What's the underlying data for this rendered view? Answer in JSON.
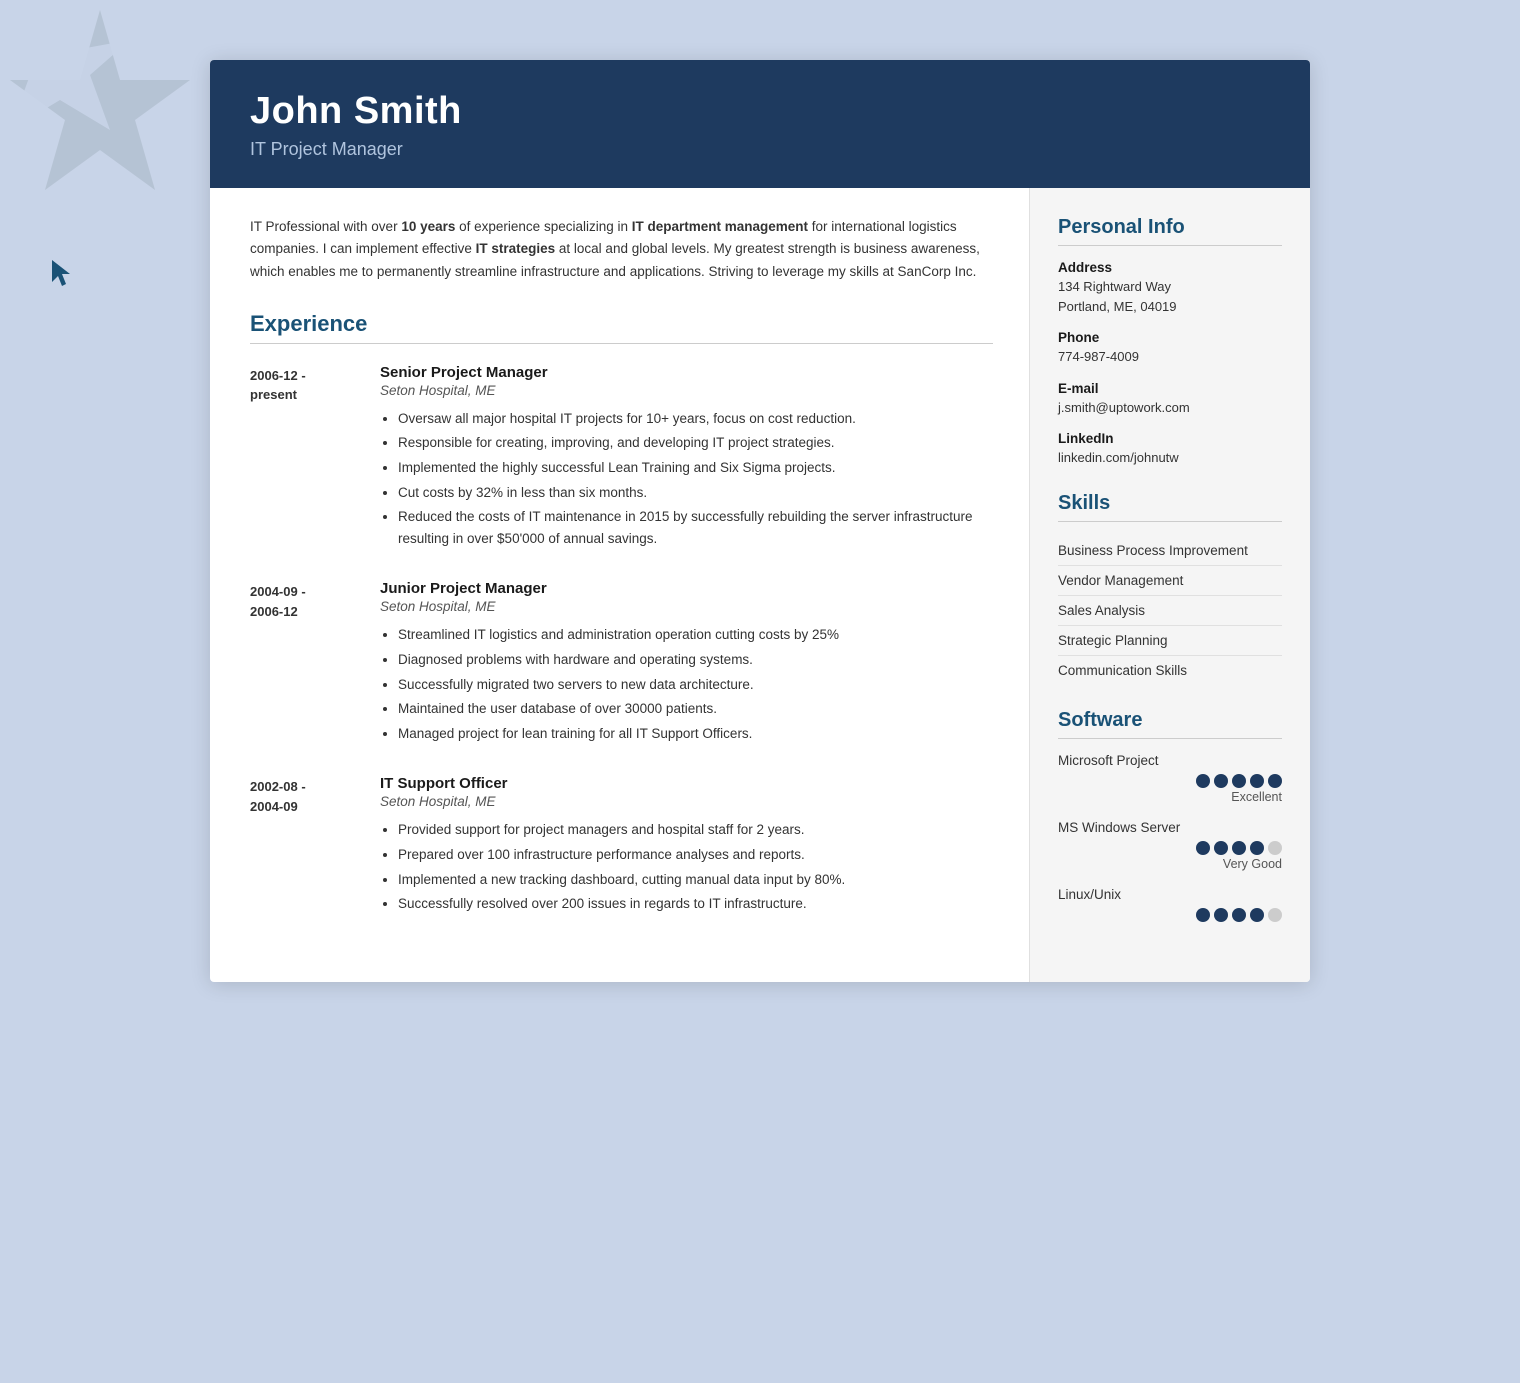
{
  "header": {
    "name": "John Smith",
    "title": "IT Project Manager"
  },
  "summary": {
    "text_parts": [
      "IT Professional with over ",
      "10 years",
      " of experience specializing in ",
      "IT department management",
      " for international logistics companies. I can implement effective ",
      "IT strategies",
      " at local and global levels. My greatest strength is business awareness, which enables me to permanently streamline infrastructure and applications. Striving to leverage my skills at SanCorp Inc."
    ]
  },
  "experience": {
    "section_title": "Experience",
    "entries": [
      {
        "date_start": "2006-12 -",
        "date_end": "present",
        "job_title": "Senior Project Manager",
        "company": "Seton Hospital, ME",
        "bullets": [
          "Oversaw all major hospital IT projects for 10+ years, focus on cost reduction.",
          "Responsible for creating, improving, and developing IT project strategies.",
          "Implemented the highly successful Lean Training and Six Sigma projects.",
          "Cut costs by 32% in less than six months.",
          "Reduced the costs of IT maintenance in 2015 by successfully rebuilding the server infrastructure resulting in over $50'000 of annual savings."
        ]
      },
      {
        "date_start": "2004-09 -",
        "date_end": "2006-12",
        "job_title": "Junior Project Manager",
        "company": "Seton Hospital, ME",
        "bullets": [
          "Streamlined IT logistics and administration operation cutting costs by 25%",
          "Diagnosed problems with hardware and operating systems.",
          "Successfully migrated two servers to new data architecture.",
          "Maintained the user database of over 30000 patients.",
          "Managed project for lean training for all IT Support Officers."
        ]
      },
      {
        "date_start": "2002-08 -",
        "date_end": "2004-09",
        "job_title": "IT Support Officer",
        "company": "Seton Hospital, ME",
        "bullets": [
          "Provided support for project managers and hospital staff for 2 years.",
          "Prepared over 100 infrastructure performance analyses and reports.",
          "Implemented a new tracking dashboard, cutting manual data input by 80%.",
          "Successfully resolved over 200 issues in regards to IT infrastructure."
        ]
      }
    ]
  },
  "personal_info": {
    "section_title": "Personal Info",
    "items": [
      {
        "label": "Address",
        "value": "134 Rightward Way\nPortland, ME, 04019"
      },
      {
        "label": "Phone",
        "value": "774-987-4009"
      },
      {
        "label": "E-mail",
        "value": "j.smith@uptowork.com"
      },
      {
        "label": "LinkedIn",
        "value": "linkedin.com/johnutw"
      }
    ]
  },
  "skills": {
    "section_title": "Skills",
    "items": [
      "Business Process Improvement",
      "Vendor Management",
      "Sales Analysis",
      "Strategic Planning",
      "Communication Skills"
    ]
  },
  "software": {
    "section_title": "Software",
    "items": [
      {
        "name": "Microsoft Project",
        "filled": 5,
        "total": 5,
        "rating_label": "Excellent"
      },
      {
        "name": "MS Windows Server",
        "filled": 4,
        "total": 5,
        "rating_label": "Very Good"
      },
      {
        "name": "Linux/Unix",
        "filled": 4,
        "total": 5,
        "rating_label": ""
      }
    ]
  }
}
